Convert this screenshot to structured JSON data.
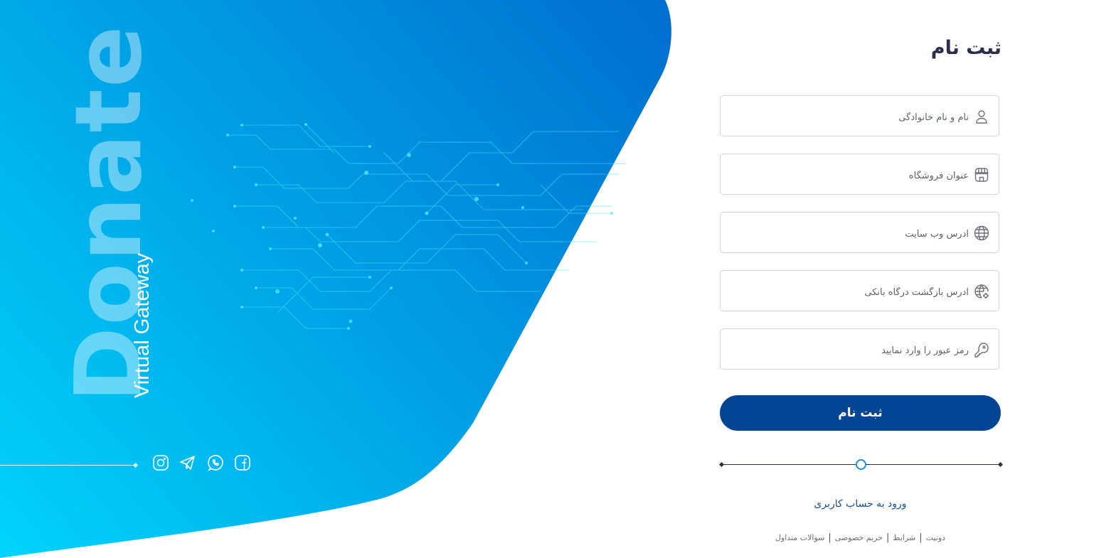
{
  "brand": {
    "word": "Donate",
    "tagline": "Virtual Gateway"
  },
  "colors": {
    "hero_gradient_top": "#0070d0",
    "hero_gradient_bottom": "#00d4fb",
    "primary_button": "#034595",
    "title_text": "#2b2f4a",
    "link_text": "#1a4f93",
    "step_knob": "#1a8fe8"
  },
  "social": [
    {
      "name": "instagram",
      "icon": "instagram-icon"
    },
    {
      "name": "telegram",
      "icon": "telegram-icon"
    },
    {
      "name": "whatsapp",
      "icon": "whatsapp-icon"
    },
    {
      "name": "facebook",
      "icon": "facebook-icon"
    }
  ],
  "form": {
    "title": "ثبت نام",
    "fields": [
      {
        "icon": "user-icon",
        "placeholder": "نام و نام خانوادگی",
        "value": ""
      },
      {
        "icon": "store-icon",
        "placeholder": "عنوان فروشگاه",
        "value": ""
      },
      {
        "icon": "globe-icon",
        "placeholder": "آدرس وب سایت",
        "value": ""
      },
      {
        "icon": "globe-settings-icon",
        "placeholder": "آدرس بازگشت درگاه بانکی",
        "value": ""
      },
      {
        "icon": "key-icon",
        "placeholder": "رمز عبور را وارد نمایید",
        "value": ""
      }
    ],
    "submit_label": "ثبت نام",
    "step_progress": 0.5,
    "login_link": "ورود به حساب کاربری"
  },
  "footer": {
    "links": [
      "دونیت",
      "شرایط",
      "حریم خصوصی",
      "سوالات متداول"
    ],
    "separator": "|"
  }
}
